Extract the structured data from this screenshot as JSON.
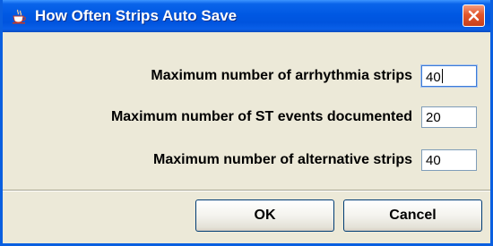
{
  "window": {
    "title": "How Often Strips Auto Save"
  },
  "fields": [
    {
      "label": "Maximum number of arrhythmia strips",
      "value": "40"
    },
    {
      "label": "Maximum number of ST events documented",
      "value": "20"
    },
    {
      "label": "Maximum number of alternative strips",
      "value": "40"
    }
  ],
  "buttons": {
    "ok_label": "OK",
    "cancel_label": "Cancel"
  },
  "icons": {
    "app": "java-coffee-cup-icon",
    "close": "close-icon"
  },
  "colors": {
    "titlebar": "#0054de",
    "close_button": "#e2562c",
    "dialog_background": "#ece9d8"
  }
}
